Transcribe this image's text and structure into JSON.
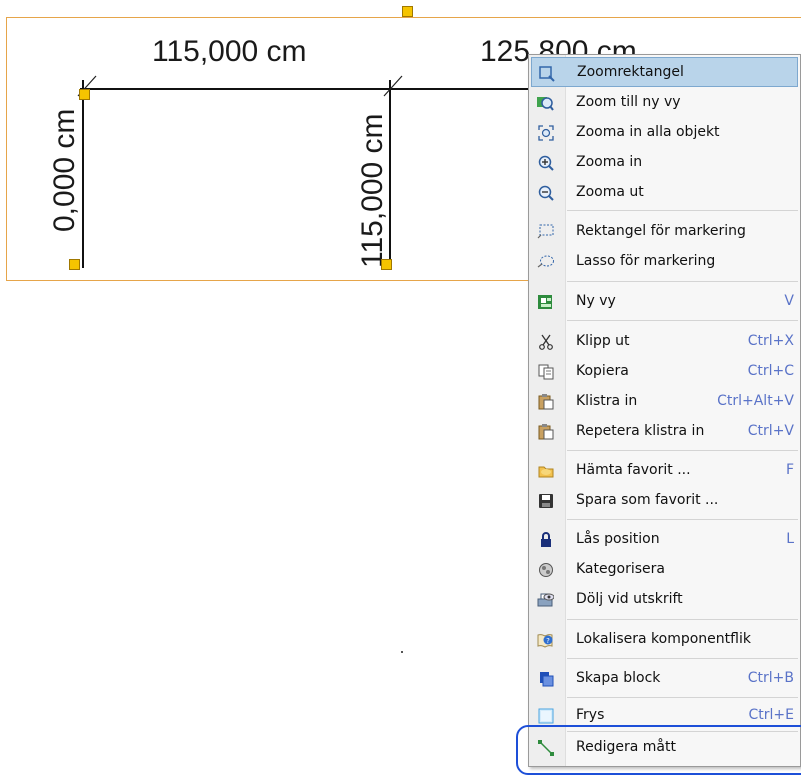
{
  "drawing": {
    "dim_top_left": "115,000 cm",
    "dim_top_right": "125,800 cm",
    "dim_left_vertical": "0,000 cm",
    "dim_mid_vertical": "115,000 cm"
  },
  "context_menu": {
    "items": [
      {
        "label": "Zoomrektangel",
        "shortcut": "",
        "icon": "zoom-rectangle-icon",
        "selected": true
      },
      {
        "label": "Zoom till ny vy",
        "shortcut": "",
        "icon": "zoom-new-view-icon"
      },
      {
        "label": "Zooma in alla objekt",
        "shortcut": "",
        "icon": "zoom-all-objects-icon"
      },
      {
        "label": "Zooma in",
        "shortcut": "",
        "icon": "zoom-in-icon"
      },
      {
        "label": "Zooma ut",
        "shortcut": "",
        "icon": "zoom-out-icon"
      },
      {
        "label": "Rektangel för markering",
        "shortcut": "",
        "icon": "rectangle-select-icon"
      },
      {
        "label": "Lasso för markering",
        "shortcut": "",
        "icon": "lasso-select-icon"
      },
      {
        "label": "Ny vy",
        "shortcut": "V",
        "icon": "new-view-icon"
      },
      {
        "label": "Klipp ut",
        "shortcut": "Ctrl+X",
        "icon": "scissors-icon"
      },
      {
        "label": "Kopiera",
        "shortcut": "Ctrl+C",
        "icon": "copy-icon"
      },
      {
        "label": "Klistra in",
        "shortcut": "Ctrl+Alt+V",
        "icon": "paste-icon"
      },
      {
        "label": "Repetera klistra in",
        "shortcut": "Ctrl+V",
        "icon": "repeat-paste-icon"
      },
      {
        "label": "Hämta favorit ...",
        "shortcut": "F",
        "icon": "folder-open-icon"
      },
      {
        "label": "Spara som favorit ...",
        "shortcut": "",
        "icon": "save-icon"
      },
      {
        "label": "Lås position",
        "shortcut": "L",
        "icon": "lock-icon"
      },
      {
        "label": "Kategorisera",
        "shortcut": "",
        "icon": "categorize-icon"
      },
      {
        "label": "Dölj vid utskrift",
        "shortcut": "",
        "icon": "hide-print-icon"
      },
      {
        "label": "Lokalisera komponentflik",
        "shortcut": "",
        "icon": "help-book-icon"
      },
      {
        "label": "Skapa block",
        "shortcut": "Ctrl+B",
        "icon": "create-block-icon"
      },
      {
        "label": "Frys",
        "shortcut": "Ctrl+E",
        "icon": "freeze-icon"
      },
      {
        "label": "Redigera mått",
        "shortcut": "",
        "icon": "edit-dimension-icon"
      }
    ]
  },
  "colors": {
    "selection": "#b9d4ea",
    "highlight_outline": "#1d4fd8",
    "handle": "#f5c400",
    "canvas_border": "#e6a54a",
    "shortcut_text": "#5a73c8"
  }
}
